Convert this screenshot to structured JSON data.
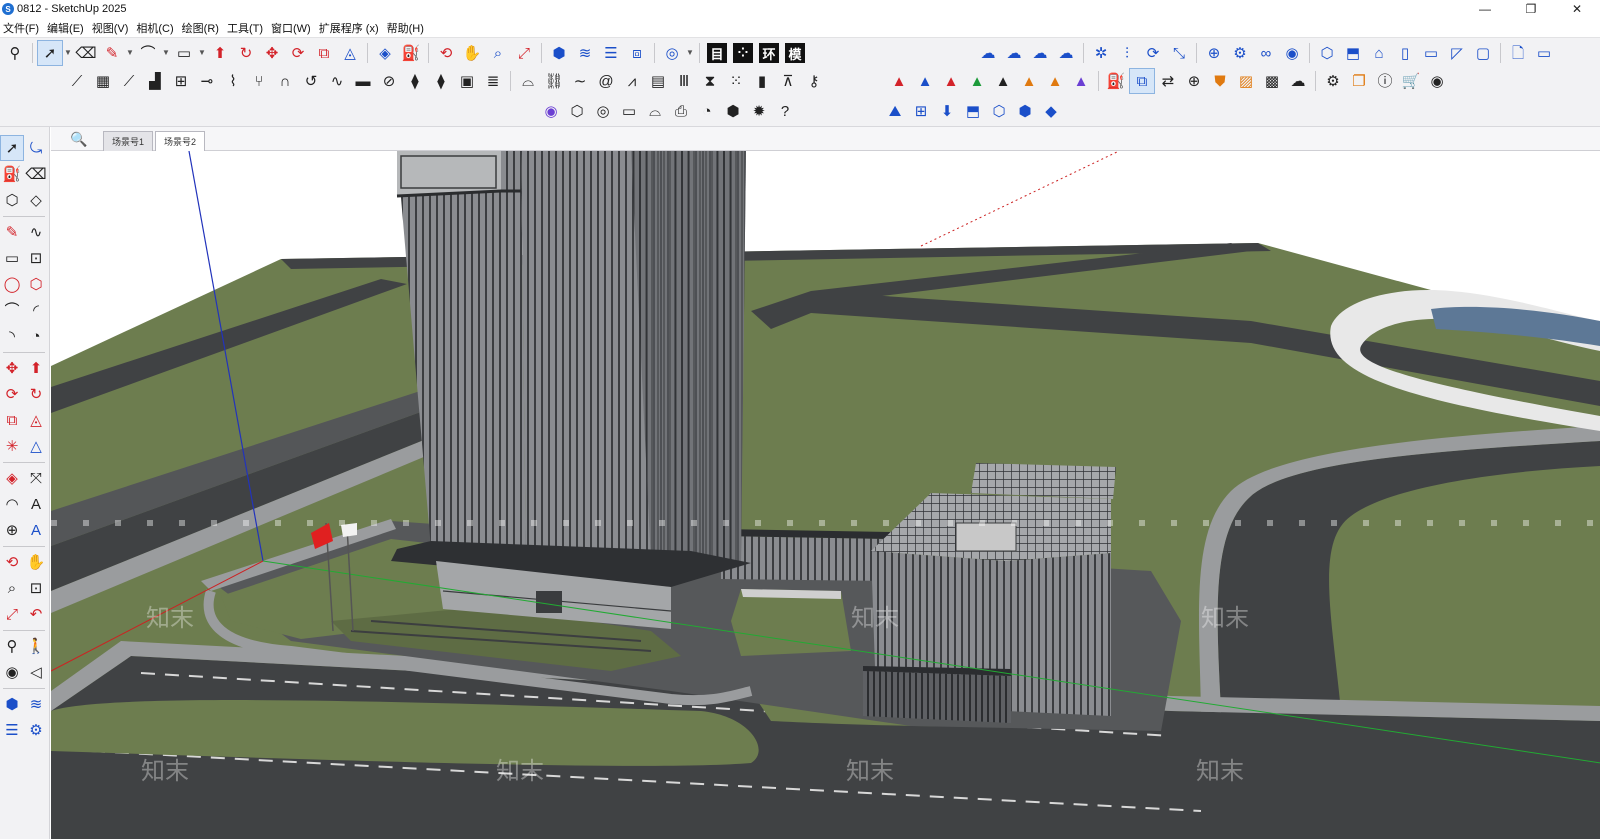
{
  "window": {
    "title": "0812 - SketchUp 2025",
    "controls": {
      "minimize": "—",
      "restore": "❐",
      "close": "✕"
    }
  },
  "menu": [
    "文件(F)",
    "编辑(E)",
    "视图(V)",
    "相机(C)",
    "绘图(R)",
    "工具(T)",
    "窗口(W)",
    "扩展程序 (x)",
    "帮助(H)"
  ],
  "toolbar": {
    "badges": [
      "目",
      "环",
      "模"
    ],
    "dot_badge": "⁘"
  },
  "scenes": {
    "search_icon": "🔍",
    "tabs": [
      {
        "label": "场景号1",
        "active": false
      },
      {
        "label": "场景号2",
        "active": true
      }
    ]
  },
  "watermark": {
    "text": "知末"
  },
  "colors": {
    "grass": "#6d7d4f",
    "road": "#404244",
    "sidewalk": "#9a9c9e",
    "building": "#8d8f92",
    "water": "#5d7896",
    "selection": "#d6e6f8"
  }
}
